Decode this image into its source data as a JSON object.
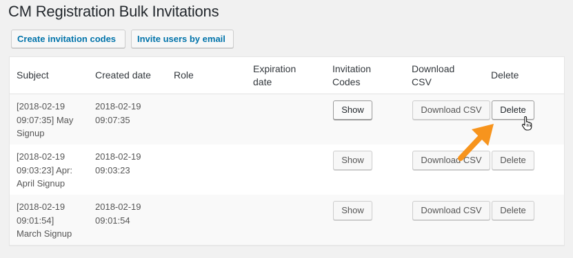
{
  "page": {
    "title": "CM Registration Bulk Invitations"
  },
  "toolbar": {
    "create_codes_label": "Create invitation codes",
    "invite_email_label": "Invite users by email"
  },
  "table": {
    "headers": {
      "subject": "Subject",
      "created_date": "Created date",
      "role": "Role",
      "expiration_line1": "Expiration",
      "expiration_line2": "date",
      "codes_line1": "Invitation",
      "codes_line2": "Codes",
      "download_line1": "Download",
      "download_line2": "CSV",
      "delete": "Delete"
    },
    "rows": [
      {
        "subject_lines": [
          "[2018-02-19",
          "09:07:35] May",
          "Signup"
        ],
        "created_lines": [
          "2018-02-19",
          "09:07:35"
        ],
        "role": "",
        "expiration": "",
        "show_label": "Show",
        "download_label": "Download CSV",
        "delete_label": "Delete"
      },
      {
        "subject_lines": [
          "[2018-02-19",
          "09:03:23] Apr:",
          "April Signup"
        ],
        "created_lines": [
          "2018-02-19",
          "09:03:23"
        ],
        "role": "",
        "expiration": "",
        "show_label": "Show",
        "download_label": "Download CSV",
        "delete_label": "Delete"
      },
      {
        "subject_lines": [
          "[2018-02-19",
          "09:01:54]",
          "March Signup"
        ],
        "created_lines": [
          "2018-02-19",
          "09:01:54"
        ],
        "role": "",
        "expiration": "",
        "show_label": "Show",
        "download_label": "Download CSV",
        "delete_label": "Delete"
      }
    ]
  },
  "annotation": {
    "arrow_color": "#f7941d",
    "arrow_icon": "arrow-icon",
    "cursor_icon": "hand-pointer-icon"
  },
  "colors": {
    "link_blue": "#0073aa",
    "background": "#f1f1f1"
  }
}
